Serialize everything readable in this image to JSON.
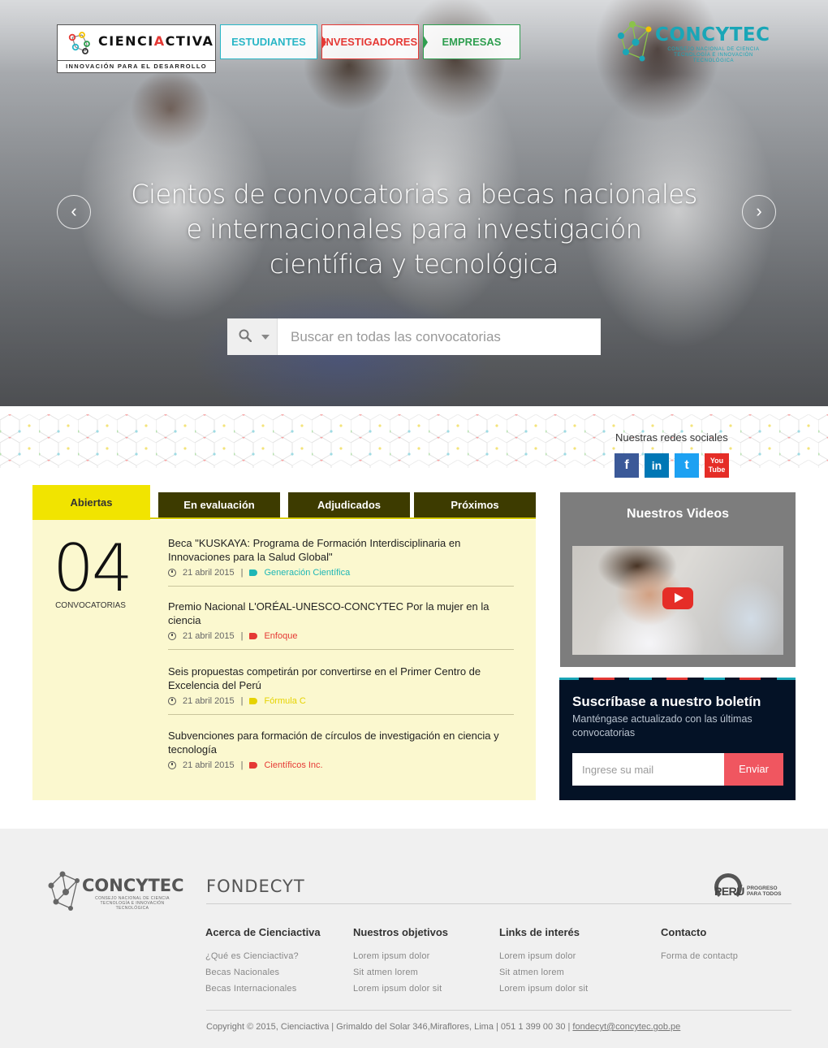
{
  "header": {
    "brand_pre": "CIENCI",
    "brand_accent": "A",
    "brand_post": "CTIVA",
    "brand_tagline": "INNOVACIÓN PARA EL DESARROLLO",
    "nav": [
      {
        "label": "ESTUDIANTES",
        "color": "#29b6c6"
      },
      {
        "label": "INVESTIGADORES",
        "color": "#e53935"
      },
      {
        "label": "EMPRESAS",
        "color": "#2e9e4f"
      }
    ],
    "partner_logo": {
      "name": "CONCYTEC",
      "subtitle": "CONSEJO NACIONAL DE CIENCIA TECNOLOGÍA E INNOVACIÓN TECNOLÓGICA"
    }
  },
  "hero": {
    "title": "Cientos de convocatorias a becas nacionales e internacionales para investigación científica y tecnológica",
    "prev_icon": "chevron-left-icon",
    "next_icon": "chevron-right-icon",
    "prev_glyph": "‹",
    "next_glyph": "›",
    "search": {
      "placeholder": "Buscar en todas las convocatorias",
      "value": ""
    }
  },
  "social": {
    "label": "Nuestras redes sociales",
    "networks": [
      {
        "name": "facebook",
        "glyph": "f",
        "color": "#3b5998"
      },
      {
        "name": "linkedin",
        "glyph": "in",
        "color": "#0077b5"
      },
      {
        "name": "twitter",
        "glyph": "t",
        "color": "#1da1f2"
      },
      {
        "name": "youtube",
        "glyph": "You Tube",
        "color": "#e52d27"
      }
    ]
  },
  "calls": {
    "tabs": [
      "Abiertas",
      "En evaluación",
      "Adjudicados",
      "Próximos"
    ],
    "active_tab": "Abiertas",
    "count": "04",
    "count_label": "CONVOCATORIAS",
    "items": [
      {
        "title": "Beca \"KUSKAYA: Programa de Formación Interdisciplinaria en Innovaciones para la Salud Global\"",
        "date": "21 abril 2015",
        "tag": "Generación Científica",
        "tag_color": "#1eb6b6"
      },
      {
        "title": "Premio Nacional L'ORÉAL-UNESCO-CONCYTEC Por la mujer en la ciencia",
        "date": "21 abril 2015",
        "tag": "Enfoque",
        "tag_color": "#e53935"
      },
      {
        "title": "Seis propuestas competirán por convertirse en el Primer Centro de Excelencia del Perú",
        "date": "21 abril 2015",
        "tag": "Fórmula C",
        "tag_color": "#e6d300"
      },
      {
        "title": "Subvenciones para formación de círculos de investigación en ciencia y tecnología",
        "date": "21 abril 2015",
        "tag": "Científicos Inc.",
        "tag_color": "#e53935"
      }
    ],
    "separator": "|"
  },
  "videos": {
    "title": "Nuestros Videos",
    "play_icon": "play-icon"
  },
  "newsletter": {
    "title": "Suscríbase a nuestro boletín",
    "text": "Manténgase actualizado con las últimas convocatorias",
    "input_placeholder": "Ingrese su mail",
    "button": "Enviar",
    "stripe_colors": [
      "#1aa6b7",
      "#e53935",
      "#1aa6b7",
      "#e53935",
      "#1aa6b7",
      "#e53935",
      "#1aa6b7"
    ]
  },
  "footer": {
    "logo_concytec": "CONCYTEC",
    "logo_concytec_sub": "CONSEJO NACIONAL DE CIENCIA TECNOLOGÍA E INNOVACIÓN TECNOLÓGICA",
    "logo_fondecyt": "FONDECYT",
    "logo_peru": "PERÚ",
    "logo_peru_sub": "PROGRESO PARA TODOS",
    "columns": [
      {
        "title": "Acerca de Cienciactiva",
        "links": [
          "¿Qué es Cienciactiva?",
          "Becas Nacionales",
          "Becas Internacionales"
        ]
      },
      {
        "title": "Nuestros objetivos",
        "links": [
          "Lorem ipsum dolor",
          "Sit atmen lorem",
          "Lorem ipsum dolor sit"
        ]
      },
      {
        "title": "Links de interés",
        "links": [
          "Lorem ipsum dolor",
          "Sit atmen lorem",
          "Lorem ipsum dolor sit"
        ]
      },
      {
        "title": "Contacto",
        "links": [
          "Forma de contactp"
        ]
      }
    ],
    "copyright": "Copyright © 2015, Cienciactiva | Grimaldo del Solar 346,Miraflores, Lima | 051 1 399 00 30 | ",
    "email": "fondecyt@concytec.gob.pe"
  }
}
